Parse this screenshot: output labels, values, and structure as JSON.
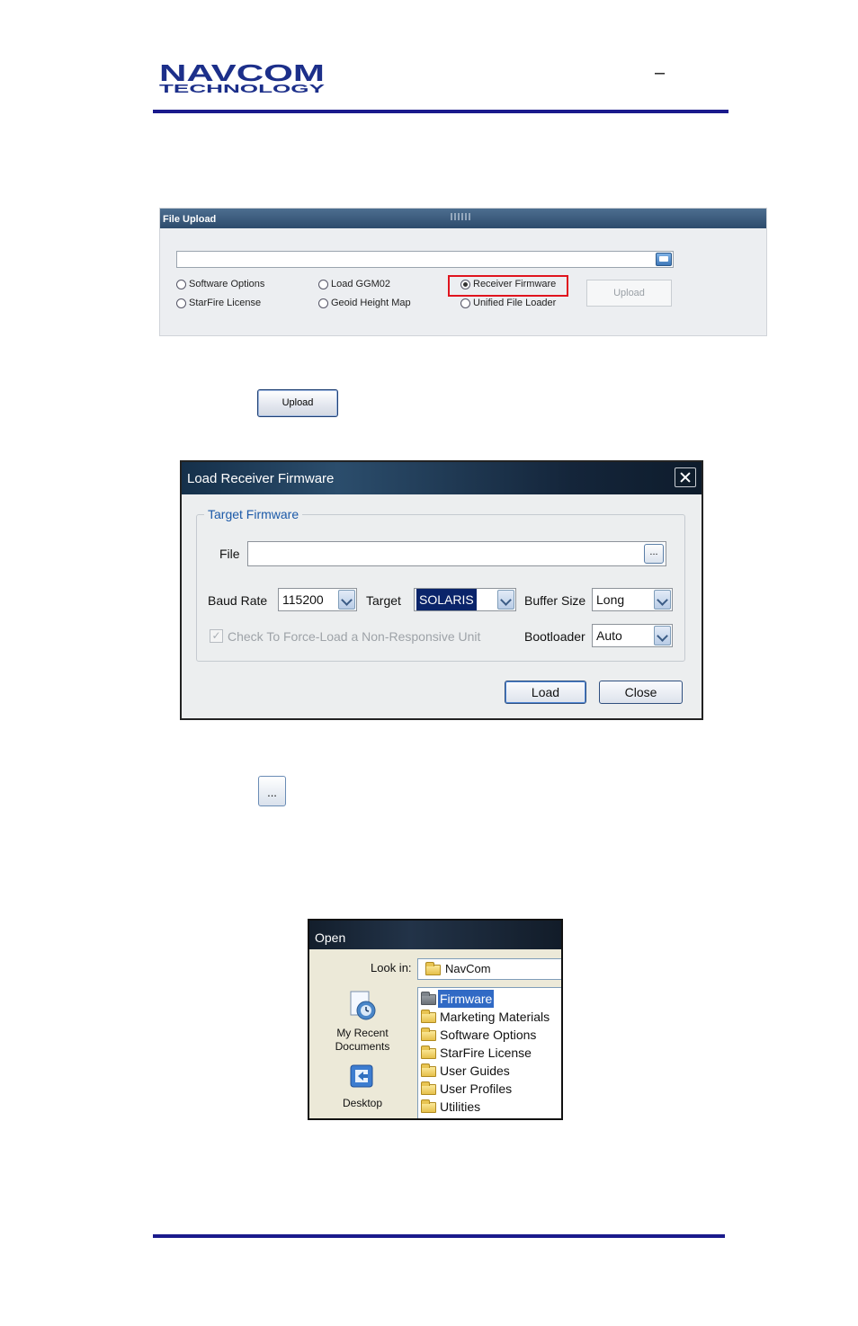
{
  "header": {
    "logo_line1": "NAVCOM",
    "logo_line2": "TECHNOLOGY",
    "dash": "–"
  },
  "file_upload": {
    "title": "File Upload",
    "path_value": "",
    "options": [
      {
        "label": "Software Options",
        "checked": false
      },
      {
        "label": "StarFire License",
        "checked": false
      },
      {
        "label": "Load GGM02",
        "checked": false
      },
      {
        "label": "Geoid Height Map",
        "checked": false
      },
      {
        "label": "Receiver Firmware",
        "checked": true
      },
      {
        "label": "Unified File Loader",
        "checked": false
      }
    ],
    "upload_label": "Upload",
    "highlight_color": "#e0141e"
  },
  "upload_button": {
    "label": "Upload"
  },
  "firmware_dialog": {
    "title": "Load Receiver Firmware",
    "group_label": "Target Firmware",
    "file_label": "File",
    "file_value": "",
    "browse_label": "...",
    "baud_rate_label": "Baud Rate",
    "baud_rate_value": "115200",
    "target_label": "Target",
    "target_value": "SOLARIS",
    "buffer_size_label": "Buffer Size",
    "buffer_size_value": "Long",
    "bootloader_label": "Bootloader",
    "bootloader_value": "Auto",
    "force_load_label": "Check To Force-Load a Non-Responsive Unit",
    "force_load_checked": true,
    "load_label": "Load",
    "close_label": "Close"
  },
  "browse_button": {
    "label": "..."
  },
  "open_dialog": {
    "title": "Open",
    "look_in_label": "Look in:",
    "look_in_value": "NavCom",
    "places": [
      {
        "label": "My Recent\nDocuments",
        "icon": "recent-documents-icon"
      },
      {
        "label": "Desktop",
        "icon": "desktop-icon"
      }
    ],
    "places_recent_line1": "My Recent",
    "places_recent_line2": "Documents",
    "places_desktop": "Desktop",
    "folders": [
      "Firmware",
      "Marketing Materials",
      "Software Options",
      "StarFire License",
      "User Guides",
      "User Profiles",
      "Utilities"
    ],
    "selected_folder": "Firmware"
  }
}
